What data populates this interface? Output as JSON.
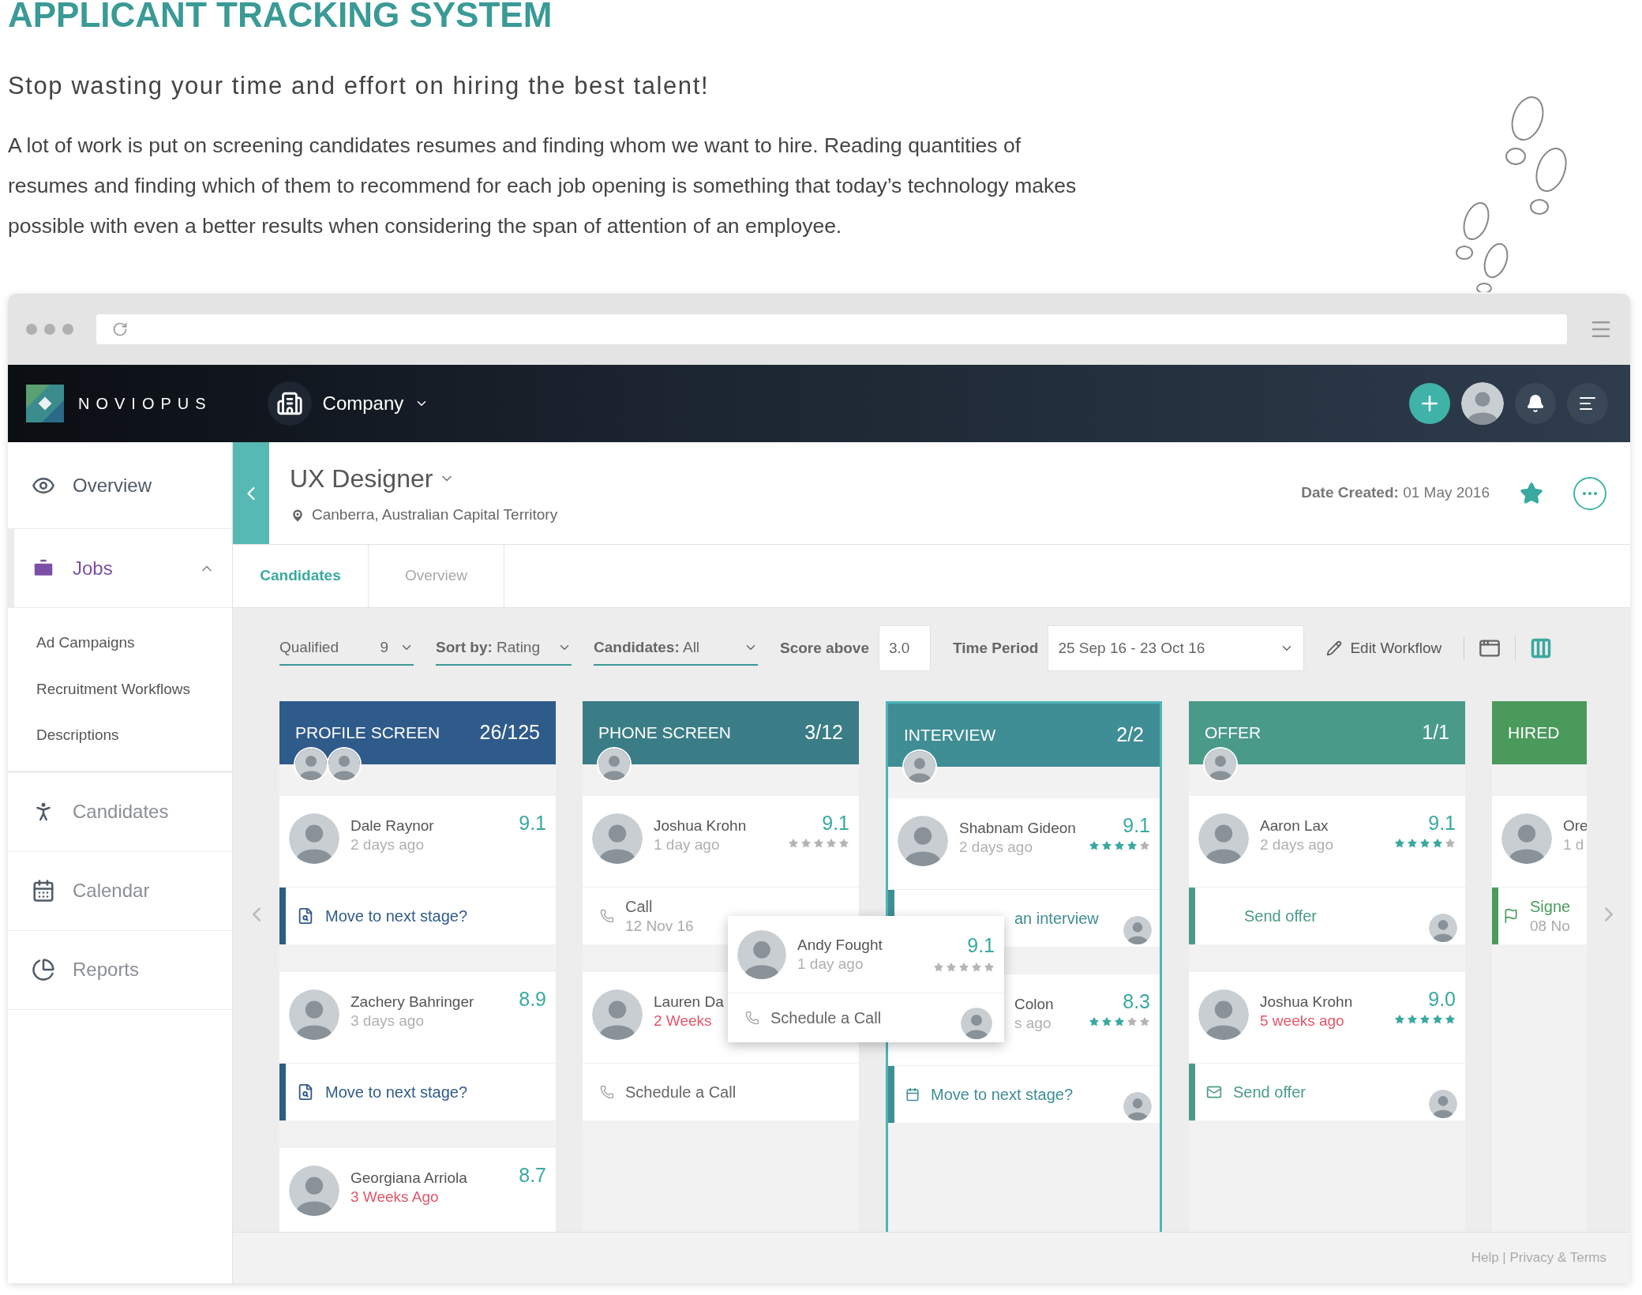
{
  "intro": {
    "title": "APPLICANT TRACKING SYSTEM",
    "subtitle": "Stop wasting your time and effort on hiring the best talent!",
    "paragraph": "A lot of work is put on screening candidates resumes and finding whom we want to hire. Reading quantities of resumes and finding which of them to recommend for each job opening is something that today’s technology makes possible with even a better results when considering the span of attention of an employee."
  },
  "app_header": {
    "brand": "NOVIOPUS",
    "company": "Company"
  },
  "sidebar": {
    "items": [
      {
        "label": "Overview",
        "kind": "eye",
        "selected": false
      },
      {
        "label": "Jobs",
        "kind": "briefcase",
        "selected": true,
        "expanded": true,
        "children": [
          {
            "label": "Ad Campaigns"
          },
          {
            "label": "Recruitment Workflows"
          },
          {
            "label": "Descriptions"
          }
        ]
      },
      {
        "label": "Candidates",
        "kind": "person",
        "selected": false
      },
      {
        "label": "Calendar",
        "kind": "calendar",
        "selected": false
      },
      {
        "label": "Reports",
        "kind": "pie",
        "selected": false
      }
    ]
  },
  "job": {
    "title": "UX Designer",
    "location": "Canberra, Australian Capital Territory",
    "date_created": "**Date Created:** 01 May 2016",
    "starred": true
  },
  "tabs": [
    {
      "label": "Candidates",
      "selected": true
    },
    {
      "label": "Overview",
      "selected": false
    }
  ],
  "filters": {
    "qualified": {
      "label": "Qualified",
      "count": "9"
    },
    "sort": "**Sort by:** Rating",
    "candidates": "**Candidates:** All",
    "score": {
      "label": "Score above",
      "value": "3.0"
    },
    "period": {
      "label": "Time Period",
      "value": "25 Sep 16 - 23 Oct 16"
    },
    "edit": "Edit Workflow",
    "views": [
      {
        "kind": "window",
        "selected": false
      },
      {
        "kind": "columns",
        "selected": true
      }
    ]
  },
  "columns": [
    {
      "title": "PROFILE SCREEN",
      "count": "26/125",
      "color": "#2f5b8b",
      "selected": false,
      "watchers": [
        {
          "kind": "picture"
        },
        {
          "kind": "picture"
        }
      ],
      "cards": [
        {
          "name": "Dale Raynor",
          "age": "2 days ago",
          "overdue": false,
          "score": "9.1",
          "avatar": true,
          "action": {
            "kind": "move",
            "text": "Move to next stage?",
            "assignee": false
          }
        },
        {
          "name": "Zachery Bahringer",
          "age": "3 days ago",
          "overdue": false,
          "score": "8.9",
          "avatar": true,
          "action": {
            "kind": "move",
            "text": "Move to next stage?",
            "assignee": false
          }
        },
        {
          "name": "Georgiana Arriola",
          "age": "3 Weeks Ago",
          "overdue": true,
          "score": "8.7",
          "avatar": true
        }
      ]
    },
    {
      "title": "PHONE SCREEN",
      "count": "3/12",
      "color": "#3a7d86",
      "selected": false,
      "watchers": [
        {
          "kind": "picture"
        }
      ],
      "cards": [
        {
          "name": "Joshua Krohn",
          "age": "1 day ago",
          "overdue": false,
          "score": "9.1",
          "stars": 0,
          "avatar": true,
          "action": {
            "kind": "call",
            "text": "Call",
            "sub": "12 Nov 16",
            "assignee": false
          }
        },
        {
          "name": "Lauren Da",
          "age": "2 Weeks",
          "overdue": true,
          "avatar": true,
          "action": {
            "kind": "call",
            "text": "Schedule a Call",
            "assignee": false
          }
        }
      ]
    },
    {
      "title": "INTERVIEW",
      "count": "2/2",
      "color": "#3f8d95",
      "selected": true,
      "watchers": [
        {
          "kind": "picture"
        }
      ],
      "cards": [
        {
          "name": "Shabnam Gideon",
          "age": "2 days ago",
          "overdue": false,
          "score": "9.1",
          "stars": 4,
          "avatar": true,
          "action": {
            "kind": "interview",
            "text": "an interview",
            "assignee": true
          }
        },
        {
          "name": "Colon",
          "age": "s ago",
          "overdue": false,
          "score": "8.3",
          "stars": 3,
          "avatar": false,
          "action": {
            "kind": "calendar",
            "text": "Move to next stage?",
            "assignee": true
          }
        }
      ]
    },
    {
      "title": "OFFER",
      "count": "1/1",
      "color": "#4a9a8a",
      "selected": false,
      "watchers": [
        {
          "kind": "picture"
        }
      ],
      "cards": [
        {
          "name": "Aaron Lax",
          "age": "2 days ago",
          "overdue": false,
          "score": "9.1",
          "stars": 4,
          "avatar": true,
          "action": {
            "kind": "offer",
            "text": "Send offer",
            "assignee": true
          }
        },
        {
          "name": "Joshua Krohn",
          "age": "5 weeks ago",
          "overdue": true,
          "score": "9.0",
          "stars": 5,
          "avatar": true,
          "action": {
            "kind": "mail",
            "text": "Send offer",
            "assignee": true
          }
        }
      ]
    },
    {
      "title": "HIRED",
      "color": "#4a9a5c",
      "selected": false,
      "cards": [
        {
          "name": "Ore",
          "age": "1 d",
          "overdue": false,
          "avatar": true,
          "action": {
            "kind": "signed",
            "text": "Signe",
            "sub": "08 No",
            "assignee": false
          }
        }
      ]
    }
  ],
  "popup": {
    "name": "Andy Fought",
    "age": "1 day ago",
    "score": "9.1",
    "stars": 0,
    "action": "Schedule a Call"
  },
  "footer": "Help | Privacy & Terms"
}
